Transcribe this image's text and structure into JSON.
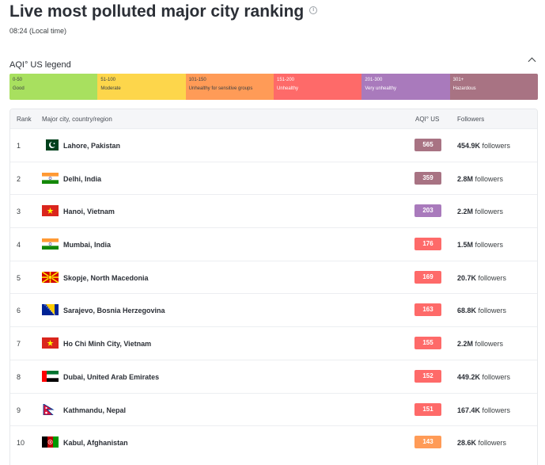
{
  "page": {
    "title": "Live most polluted major city ranking",
    "local_time": "08:24 (Local time)"
  },
  "legend": {
    "title": "AQI° US legend",
    "segments": [
      {
        "range": "0-50",
        "label": "Good",
        "color": "#a8e05f"
      },
      {
        "range": "51-100",
        "label": "Moderate",
        "color": "#fdd64b"
      },
      {
        "range": "101-150",
        "label": "Unhealthy for sensitive groups",
        "color": "#ff9b57"
      },
      {
        "range": "151-200",
        "label": "Unhealthy",
        "color": "#fe6a69"
      },
      {
        "range": "201-300",
        "label": "Very unhealthy",
        "color": "#a97abc"
      },
      {
        "range": "301+",
        "label": "Hazardous",
        "color": "#a87383"
      }
    ]
  },
  "table": {
    "headers": {
      "rank": "Rank",
      "city": "Major city, country/region",
      "aqi": "AQI° US",
      "followers": "Followers"
    },
    "followers_suffix": "followers",
    "rows": [
      {
        "rank": "1",
        "city": "Lahore, Pakistan",
        "aqi": "565",
        "followers": "454.9K",
        "aqi_color": "#a87383",
        "flag": "pakistan-flag-icon"
      },
      {
        "rank": "2",
        "city": "Delhi, India",
        "aqi": "359",
        "followers": "2.8M",
        "aqi_color": "#a87383",
        "flag": "india-flag-icon"
      },
      {
        "rank": "3",
        "city": "Hanoi, Vietnam",
        "aqi": "203",
        "followers": "2.2M",
        "aqi_color": "#a97abc",
        "flag": "vietnam-flag-icon"
      },
      {
        "rank": "4",
        "city": "Mumbai, India",
        "aqi": "176",
        "followers": "1.5M",
        "aqi_color": "#fe6a69",
        "flag": "india-flag-icon"
      },
      {
        "rank": "5",
        "city": "Skopje, North Macedonia",
        "aqi": "169",
        "followers": "20.7K",
        "aqi_color": "#fe6a69",
        "flag": "north-macedonia-flag-icon"
      },
      {
        "rank": "6",
        "city": "Sarajevo, Bosnia Herzegovina",
        "aqi": "163",
        "followers": "68.8K",
        "aqi_color": "#fe6a69",
        "flag": "bosnia-flag-icon"
      },
      {
        "rank": "7",
        "city": "Ho Chi Minh City, Vietnam",
        "aqi": "155",
        "followers": "2.2M",
        "aqi_color": "#fe6a69",
        "flag": "vietnam-flag-icon"
      },
      {
        "rank": "8",
        "city": "Dubai, United Arab Emirates",
        "aqi": "152",
        "followers": "449.2K",
        "aqi_color": "#fe6a69",
        "flag": "uae-flag-icon"
      },
      {
        "rank": "9",
        "city": "Kathmandu, Nepal",
        "aqi": "151",
        "followers": "167.4K",
        "aqi_color": "#fe6a69",
        "flag": "nepal-flag-icon"
      },
      {
        "rank": "10",
        "city": "Kabul, Afghanistan",
        "aqi": "143",
        "followers": "28.6K",
        "aqi_color": "#ff9b57",
        "flag": "afghanistan-flag-icon"
      }
    ]
  }
}
